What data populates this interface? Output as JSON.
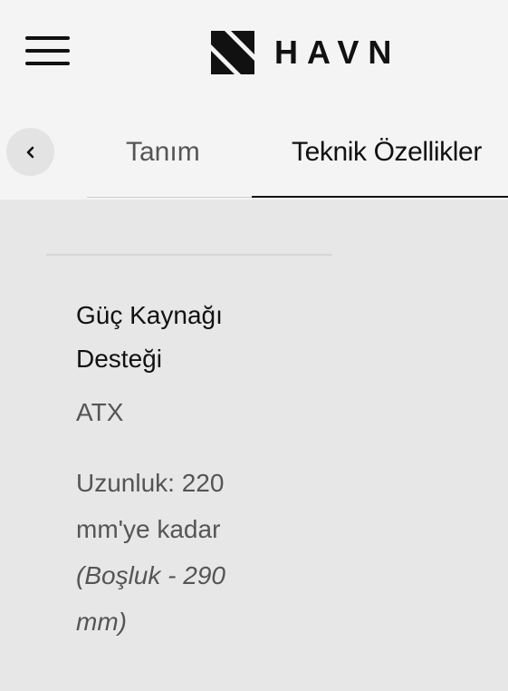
{
  "header": {
    "brand_name": "HAVN",
    "menu_icon": "hamburger-menu-icon",
    "logo_icon": "havn-logo-mark"
  },
  "tabs": {
    "back_icon": "chevron-left-icon",
    "items": [
      {
        "label": "Tanım",
        "active": false
      },
      {
        "label": "Teknik Özellikler",
        "active": true
      }
    ]
  },
  "spec": {
    "title": "Güç Kaynağı Desteği",
    "value": "ATX",
    "note_plain": "Uzunluk: 220 mm'ye kadar",
    "note_italic": "(Boşluk - 290 mm)"
  },
  "colors": {
    "header_background": "#f4f4f4",
    "content_background": "#e7e7e7",
    "text_primary": "#111111",
    "text_secondary": "#555555",
    "back_button_background": "#e3e3e3"
  }
}
